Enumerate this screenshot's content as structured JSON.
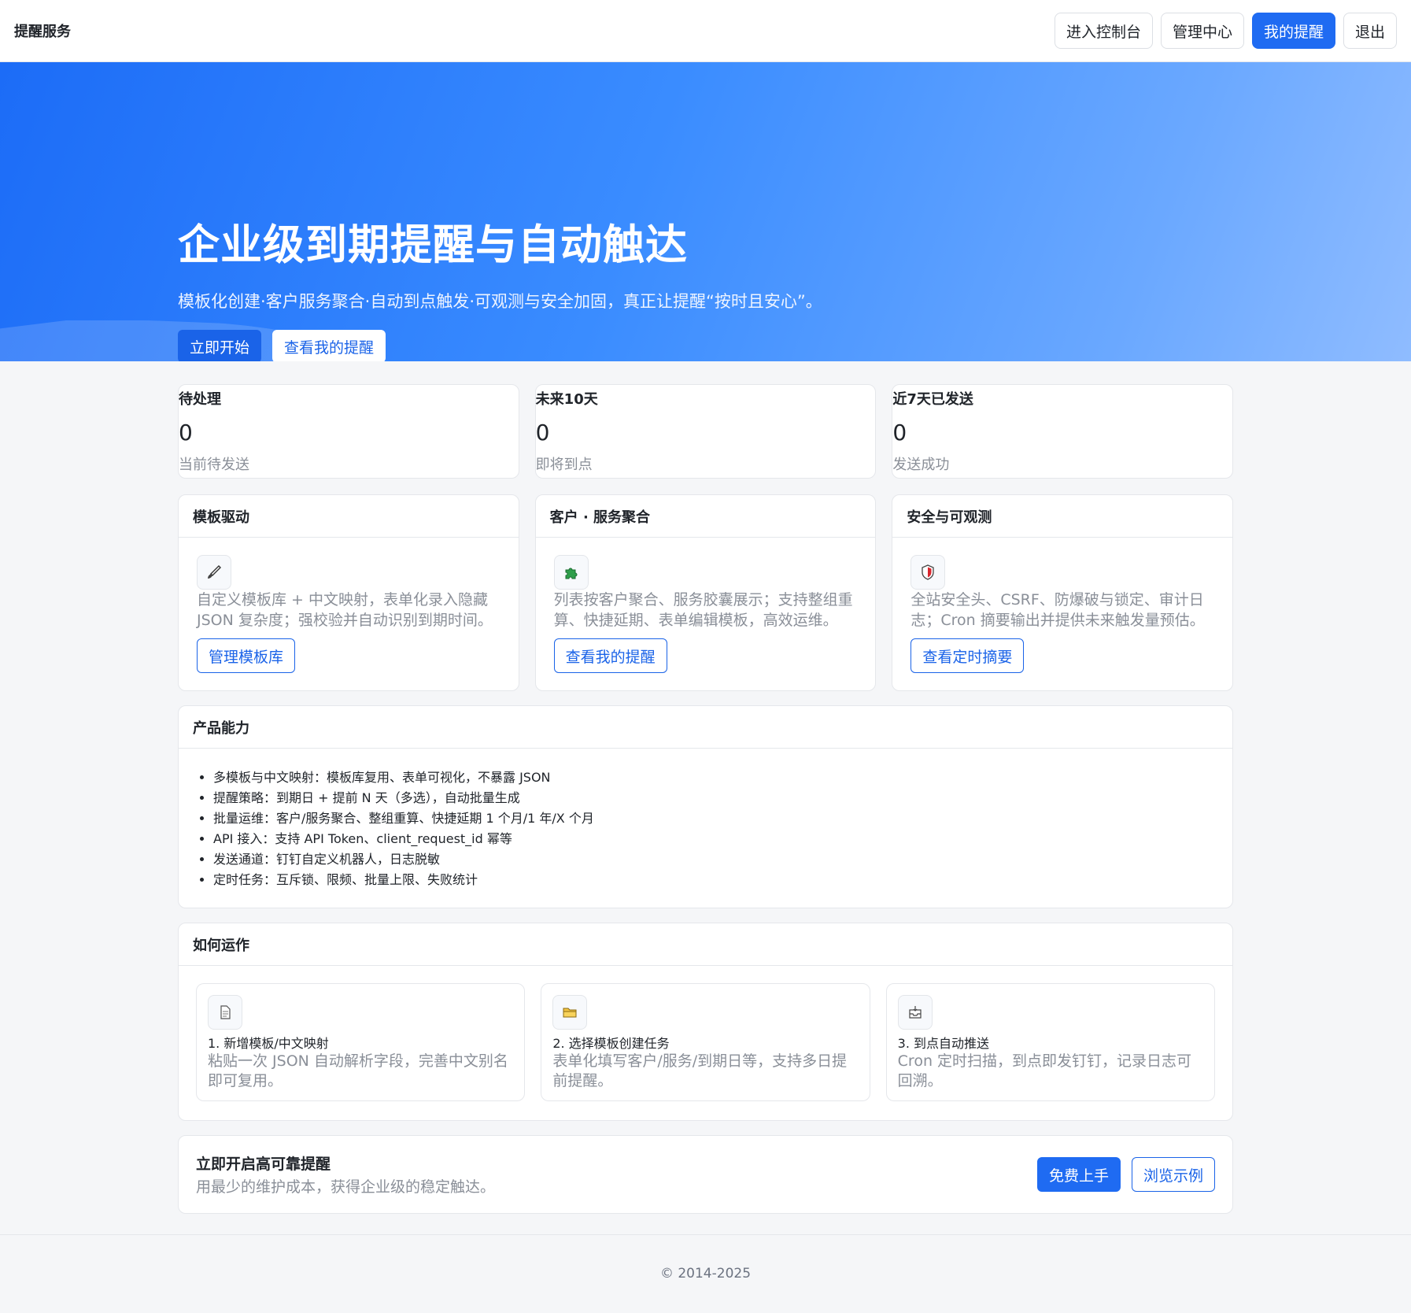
{
  "navbar": {
    "brand": "提醒服务",
    "buttons": [
      {
        "label": "进入控制台",
        "active": false
      },
      {
        "label": "管理中心",
        "active": false
      },
      {
        "label": "我的提醒",
        "active": true
      },
      {
        "label": "退出",
        "active": false
      }
    ]
  },
  "hero": {
    "title": "企业级到期提醒与自动触达",
    "subtitle": "模板化创建·客户服务聚合·自动到点触发·可观测与安全加固，真正让提醒“按时且安心”。",
    "primary_btn": "立即开始",
    "secondary_btn": "查看我的提醒"
  },
  "stats": [
    {
      "label": "待处理",
      "value": "0",
      "hint": "当前待发送"
    },
    {
      "label": "未来10天",
      "value": "0",
      "hint": "即将到点"
    },
    {
      "label": "近7天已发送",
      "value": "0",
      "hint": "发送成功"
    }
  ],
  "features": [
    {
      "title": "模板驱动",
      "icon": "brush-icon",
      "desc": "自定义模板库 + 中文映射，表单化录入隐藏 JSON 复杂度；强校验并自动识别到期时间。",
      "button": "管理模板库"
    },
    {
      "title": "客户 · 服务聚合",
      "icon": "puzzle-icon",
      "desc": "列表按客户聚合、服务胶囊展示；支持整组重算、快捷延期、表单编辑模板，高效运维。",
      "button": "查看我的提醒"
    },
    {
      "title": "安全与可观测",
      "icon": "shield-icon",
      "desc": "全站安全头、CSRF、防爆破与锁定、审计日志；Cron 摘要输出并提供未来触发量预估。",
      "button": "查看定时摘要"
    }
  ],
  "capabilities": {
    "title": "产品能力",
    "items": [
      "多模板与中文映射：模板库复用、表单可视化，不暴露 JSON",
      "提醒策略：到期日 + 提前 N 天（多选），自动批量生成",
      "批量运维：客户/服务聚合、整组重算、快捷延期 1 个月/1 年/X 个月",
      "API 接入：支持 API Token、client_request_id 幂等",
      "发送通道：钉钉自定义机器人，日志脱敏",
      "定时任务：互斥锁、限频、批量上限、失败统计"
    ]
  },
  "how": {
    "title": "如何运作",
    "steps": [
      {
        "icon": "document-icon",
        "title": "1. 新增模板/中文映射",
        "desc": "粘贴一次 JSON 自动解析字段，完善中文别名即可复用。"
      },
      {
        "icon": "folder-icon",
        "title": "2. 选择模板创建任务",
        "desc": "表单化填写客户/服务/到期日等，支持多日提前提醒。"
      },
      {
        "icon": "inbox-icon",
        "title": "3. 到点自动推送",
        "desc": "Cron 定时扫描，到点即发钉钉，记录日志可回溯。"
      }
    ]
  },
  "cta": {
    "title": "立即开启高可靠提醒",
    "subtitle": "用最少的维护成本，获得企业级的稳定触达。",
    "primary_btn": "免费上手",
    "secondary_btn": "浏览示例"
  },
  "footer": {
    "copyright": "© 2014-2025"
  },
  "colors": {
    "accent": "#1f6bf2",
    "hero_start": "#1c6cf7",
    "hero_end": "#8fbcff"
  }
}
